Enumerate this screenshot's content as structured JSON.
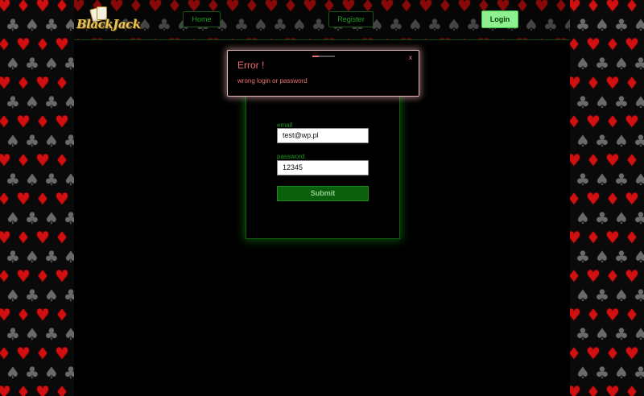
{
  "header": {
    "logo_text": "BlackJack",
    "nav": {
      "home_label": "Home",
      "register_label": "Register",
      "login_label": "Login"
    }
  },
  "background": {
    "suits": [
      "heart",
      "club",
      "diamond",
      "spade"
    ]
  },
  "login_form": {
    "email_label": "email",
    "email_value": "test@wp.pl",
    "password_label": "password",
    "password_value": "12345",
    "submit_label": "Submit"
  },
  "error_modal": {
    "title": "Error !",
    "message": "wrong login or password",
    "close_label": "x",
    "progress": 0.3
  },
  "colors": {
    "accent_green": "#1fa01f",
    "login_green": "#8ff08f",
    "error_red": "#f07070",
    "suit_red": "#d01010",
    "suit_gray": "#6a6a6a"
  }
}
